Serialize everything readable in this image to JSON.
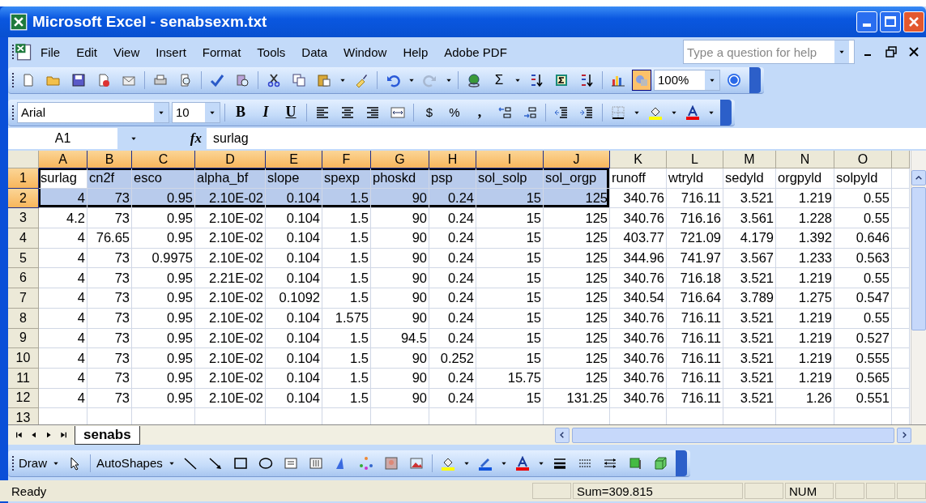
{
  "window": {
    "title": "Microsoft Excel - senabsexm.txt"
  },
  "menu": [
    "File",
    "Edit",
    "View",
    "Insert",
    "Format",
    "Tools",
    "Data",
    "Window",
    "Help",
    "Adobe PDF"
  ],
  "help_box": {
    "placeholder": "Type a question for help"
  },
  "standard_toolbar": {
    "autosum": "Σ",
    "zoom": "100%"
  },
  "formatting_toolbar": {
    "font": "Arial",
    "size": "10",
    "bold": "B",
    "italic": "I",
    "underline": "U",
    "currency": "$",
    "percent": "%",
    "comma": ","
  },
  "formula_bar": {
    "name_box": "A1",
    "function_label": "fx",
    "content": "surlag"
  },
  "columns": [
    {
      "letter": "A",
      "selected": true
    },
    {
      "letter": "B",
      "selected": true
    },
    {
      "letter": "C",
      "selected": true
    },
    {
      "letter": "D",
      "selected": true
    },
    {
      "letter": "E",
      "selected": true
    },
    {
      "letter": "F",
      "selected": true
    },
    {
      "letter": "G",
      "selected": true
    },
    {
      "letter": "H",
      "selected": true
    },
    {
      "letter": "I",
      "selected": true
    },
    {
      "letter": "J",
      "selected": true
    },
    {
      "letter": "K",
      "selected": false
    },
    {
      "letter": "L",
      "selected": false
    },
    {
      "letter": "M",
      "selected": false
    },
    {
      "letter": "N",
      "selected": false
    },
    {
      "letter": "O",
      "selected": false
    }
  ],
  "rows": [
    {
      "number": "1",
      "selected": true,
      "kind": "text",
      "cells": [
        "surlag",
        "cn2f",
        "esco",
        "alpha_bf",
        "slope",
        "spexp",
        "phoskd",
        "psp",
        "sol_solp",
        "sol_orgp",
        "runoff",
        "wtryld",
        "sedyld",
        "orgpyld",
        "solpyld"
      ]
    },
    {
      "number": "2",
      "selected": true,
      "kind": "number",
      "cells": [
        "4",
        "73",
        "0.95",
        "2.10E-02",
        "0.104",
        "1.5",
        "90",
        "0.24",
        "15",
        "125",
        "340.76",
        "716.11",
        "3.521",
        "1.219",
        "0.55"
      ]
    },
    {
      "number": "3",
      "selected": false,
      "kind": "number",
      "cells": [
        "4.2",
        "73",
        "0.95",
        "2.10E-02",
        "0.104",
        "1.5",
        "90",
        "0.24",
        "15",
        "125",
        "340.76",
        "716.16",
        "3.561",
        "1.228",
        "0.55"
      ]
    },
    {
      "number": "4",
      "selected": false,
      "kind": "number",
      "cells": [
        "4",
        "76.65",
        "0.95",
        "2.10E-02",
        "0.104",
        "1.5",
        "90",
        "0.24",
        "15",
        "125",
        "403.77",
        "721.09",
        "4.179",
        "1.392",
        "0.646"
      ]
    },
    {
      "number": "5",
      "selected": false,
      "kind": "number",
      "cells": [
        "4",
        "73",
        "0.9975",
        "2.10E-02",
        "0.104",
        "1.5",
        "90",
        "0.24",
        "15",
        "125",
        "344.96",
        "741.97",
        "3.567",
        "1.233",
        "0.563"
      ]
    },
    {
      "number": "6",
      "selected": false,
      "kind": "number",
      "cells": [
        "4",
        "73",
        "0.95",
        "2.21E-02",
        "0.104",
        "1.5",
        "90",
        "0.24",
        "15",
        "125",
        "340.76",
        "716.18",
        "3.521",
        "1.219",
        "0.55"
      ]
    },
    {
      "number": "7",
      "selected": false,
      "kind": "number",
      "cells": [
        "4",
        "73",
        "0.95",
        "2.10E-02",
        "0.1092",
        "1.5",
        "90",
        "0.24",
        "15",
        "125",
        "340.54",
        "716.64",
        "3.789",
        "1.275",
        "0.547"
      ]
    },
    {
      "number": "8",
      "selected": false,
      "kind": "number",
      "cells": [
        "4",
        "73",
        "0.95",
        "2.10E-02",
        "0.104",
        "1.575",
        "90",
        "0.24",
        "15",
        "125",
        "340.76",
        "716.11",
        "3.521",
        "1.219",
        "0.55"
      ]
    },
    {
      "number": "9",
      "selected": false,
      "kind": "number",
      "cells": [
        "4",
        "73",
        "0.95",
        "2.10E-02",
        "0.104",
        "1.5",
        "94.5",
        "0.24",
        "15",
        "125",
        "340.76",
        "716.11",
        "3.521",
        "1.219",
        "0.527"
      ]
    },
    {
      "number": "10",
      "selected": false,
      "kind": "number",
      "cells": [
        "4",
        "73",
        "0.95",
        "2.10E-02",
        "0.104",
        "1.5",
        "90",
        "0.252",
        "15",
        "125",
        "340.76",
        "716.11",
        "3.521",
        "1.219",
        "0.555"
      ]
    },
    {
      "number": "11",
      "selected": false,
      "kind": "number",
      "cells": [
        "4",
        "73",
        "0.95",
        "2.10E-02",
        "0.104",
        "1.5",
        "90",
        "0.24",
        "15.75",
        "125",
        "340.76",
        "716.11",
        "3.521",
        "1.219",
        "0.565"
      ]
    },
    {
      "number": "12",
      "selected": false,
      "kind": "number",
      "cells": [
        "4",
        "73",
        "0.95",
        "2.10E-02",
        "0.104",
        "1.5",
        "90",
        "0.24",
        "15",
        "131.25",
        "340.76",
        "716.11",
        "3.521",
        "1.26",
        "0.551"
      ]
    },
    {
      "number": "13",
      "selected": false,
      "kind": "text",
      "cells": []
    }
  ],
  "sheet_tabs": [
    {
      "label": "senabs",
      "selected": true
    }
  ],
  "drawing_toolbar": {
    "draw": "Draw",
    "autoshapes": "AutoShapes"
  },
  "status_bar": {
    "message": "Ready",
    "sum": "Sum=309.815",
    "num": "NUM"
  }
}
